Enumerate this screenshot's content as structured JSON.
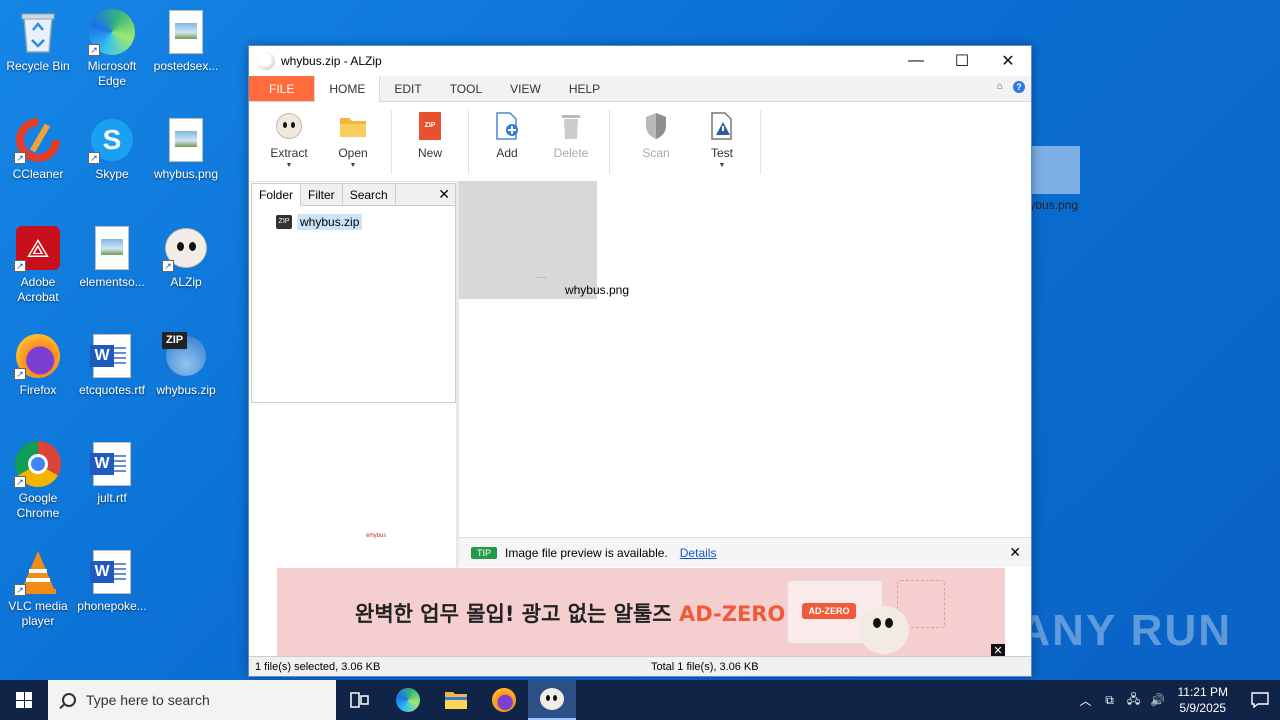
{
  "desktop": {
    "icons": [
      {
        "label": "Recycle Bin"
      },
      {
        "label": "Microsoft Edge"
      },
      {
        "label": "postedsex..."
      },
      {
        "label": "CCleaner"
      },
      {
        "label": "Skype"
      },
      {
        "label": "whybus.png"
      },
      {
        "label": "Adobe Acrobat"
      },
      {
        "label": "elementso..."
      },
      {
        "label": "ALZip"
      },
      {
        "label": "Firefox"
      },
      {
        "label": "etcquotes.rtf"
      },
      {
        "label": "whybus.zip"
      },
      {
        "label": "Google Chrome"
      },
      {
        "label": "jult.rtf"
      },
      {
        "label": "VLC media player"
      },
      {
        "label": "phonepoke..."
      }
    ],
    "drag_label": "whybus.png",
    "watermark": "ANY RUN"
  },
  "window": {
    "title": "whybus.zip - ALZip",
    "menu": [
      "FILE",
      "HOME",
      "EDIT",
      "TOOL",
      "VIEW",
      "HELP"
    ],
    "ribbon": {
      "extract": "Extract",
      "open": "Open",
      "new": "New",
      "add": "Add",
      "delete": "Delete",
      "scan": "Scan",
      "test": "Test"
    },
    "left_tabs": [
      "Folder",
      "Filter",
      "Search"
    ],
    "tree_item": "whybus.zip",
    "preview_caption": "whybus",
    "file_item": "whybus.png",
    "tip": {
      "tag": "TIP",
      "message": "Image file preview is available.",
      "link": "Details"
    },
    "ad": {
      "text": "완벽한 업무 몰입! 광고 없는 알툴즈 ",
      "brand": "AD-ZERO",
      "badge": "AD-ZERO"
    },
    "status_left": "1 file(s) selected, 3.06 KB",
    "status_right": "Total 1 file(s), 3.06 KB"
  },
  "taskbar": {
    "search_placeholder": "Type here to search",
    "time": "11:21 PM",
    "date": "5/9/2025"
  },
  "colors": {
    "file_menu": "#ff6b3d",
    "ad_brand": "#ef5b3a",
    "tip_tag": "#239a45",
    "taskbar": "#0f2447"
  }
}
